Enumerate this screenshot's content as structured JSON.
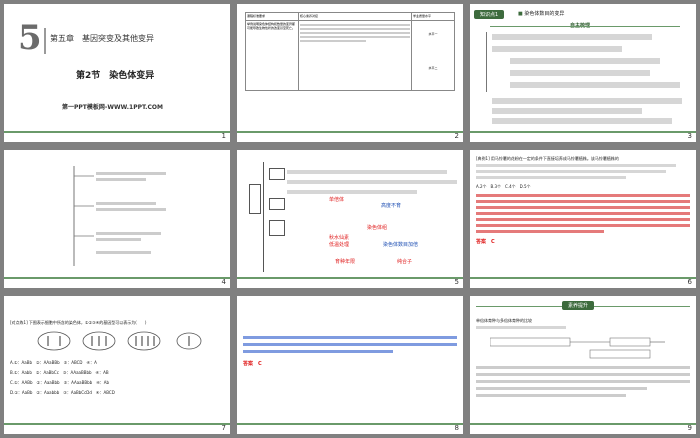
{
  "slides": [
    {
      "number": "1",
      "chapter_num": "5",
      "chapter_title": "第五章　基因突变及其他变异",
      "section_title": "第2节　染色体变异",
      "website": "第一PPT模板网-WWW.1PPT.COM"
    },
    {
      "number": "2",
      "headers": [
        "课程标准要求",
        "核心素养对接",
        "学业质量水平"
      ],
      "standard": "举例说明染色体结构和数量的变异都可能导致生物性状的改变甚至死亡。",
      "levels": [
        "水平一",
        "水平二"
      ]
    },
    {
      "number": "3",
      "badge": "知识点1",
      "heading": "染色体数目的变异",
      "sub": "自主梳理"
    },
    {
      "number": "4"
    },
    {
      "number": "5",
      "red_words": [
        "单倍体",
        "染色体组",
        "秋水仙素",
        "低温处理",
        "育种年限",
        "纯合子"
      ],
      "blue_words": [
        "高度不育",
        "染色体数目加倍"
      ]
    },
    {
      "number": "6",
      "example": "[典例1] 用马铃薯的花粉在一定的条件下直接培养成马铃薯植株。该马铃薯植株的",
      "options": "A.2个　B.3个　C.4个　D.5个",
      "answer": "答案　C"
    },
    {
      "number": "7",
      "question": "[对点练1] 下图表示细胞中所含的染色体，①②③④的基因型可以表示为(　　)",
      "options": [
        "A.①：AaBb　②：AAaBBb　③：ABCD　④：A",
        "B.①：Aabb　②：AaBbCc　③：AAaaBBbb　④：AB",
        "C.①：AABb　②：AaaBbb　③：AAaaBBbb　④：Ab",
        "D.①：AaBb　②：Aaabbb　③：AaBbCcDd　④：ABCD"
      ]
    },
    {
      "number": "8",
      "answer": "答案　C"
    },
    {
      "number": "9",
      "banner": "素养提升",
      "title": "单倍体育种与多倍体育种的比较"
    }
  ]
}
